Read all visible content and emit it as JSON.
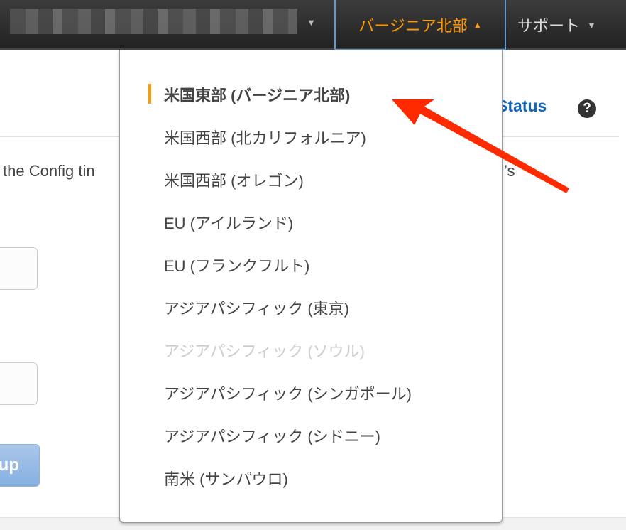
{
  "nav": {
    "account_label": "",
    "region_label": "バージニア北部",
    "support_label": "サポート"
  },
  "header": {
    "status_link": "Status",
    "help_icon": "?"
  },
  "content": {
    "text_left": "the Config tin",
    "text_right": "’s",
    "button_label": "up"
  },
  "dropdown": {
    "items": [
      {
        "label": "米国東部 (バージニア北部)",
        "state": "selected"
      },
      {
        "label": "米国西部 (北カリフォルニア)",
        "state": "normal"
      },
      {
        "label": "米国西部 (オレゴン)",
        "state": "normal"
      },
      {
        "label": "EU (アイルランド)",
        "state": "normal"
      },
      {
        "label": "EU (フランクフルト)",
        "state": "normal"
      },
      {
        "label": "アジアパシフィック (東京)",
        "state": "normal"
      },
      {
        "label": "アジアパシフィック (ソウル)",
        "state": "disabled"
      },
      {
        "label": "アジアパシフィック (シンガポール)",
        "state": "normal"
      },
      {
        "label": "アジアパシフィック (シドニー)",
        "state": "normal"
      },
      {
        "label": "南米 (サンパウロ)",
        "state": "normal"
      }
    ]
  },
  "colors": {
    "accent": "#ff9900",
    "link": "#1166bb",
    "annotation_arrow": "#ff2a00",
    "nav_bg": "#2a2a2a"
  }
}
